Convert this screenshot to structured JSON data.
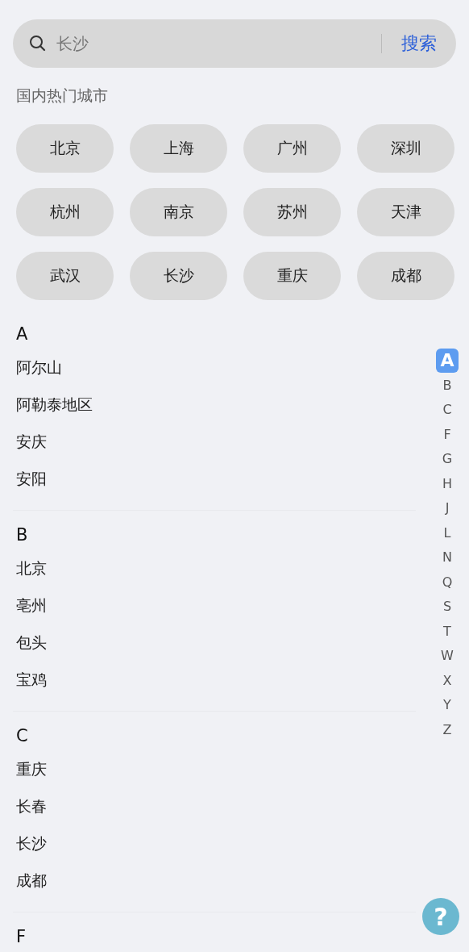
{
  "search": {
    "value": "长沙",
    "button": "搜索"
  },
  "hot_cities": {
    "title": "国内热门城市",
    "items": [
      "北京",
      "上海",
      "广州",
      "深圳",
      "杭州",
      "南京",
      "苏州",
      "天津",
      "武汉",
      "长沙",
      "重庆",
      "成都"
    ]
  },
  "sections": [
    {
      "letter": "A",
      "cities": [
        "阿尔山",
        "阿勒泰地区",
        "安庆",
        "安阳"
      ]
    },
    {
      "letter": "B",
      "cities": [
        "北京",
        "亳州",
        "包头",
        "宝鸡"
      ]
    },
    {
      "letter": "C",
      "cities": [
        "重庆",
        "长春",
        "长沙",
        "成都"
      ]
    },
    {
      "letter": "F"
    }
  ],
  "index_bar": [
    {
      "letter": "A",
      "selected": true
    },
    {
      "letter": "B",
      "selected": false
    },
    {
      "letter": "C",
      "selected": false
    },
    {
      "letter": "F",
      "selected": false
    },
    {
      "letter": "G",
      "selected": false
    },
    {
      "letter": "H",
      "selected": false
    },
    {
      "letter": "J",
      "selected": false
    },
    {
      "letter": "L",
      "selected": false
    },
    {
      "letter": "N",
      "selected": false
    },
    {
      "letter": "Q",
      "selected": false
    },
    {
      "letter": "S",
      "selected": false
    },
    {
      "letter": "T",
      "selected": false
    },
    {
      "letter": "W",
      "selected": false
    },
    {
      "letter": "X",
      "selected": false
    },
    {
      "letter": "Y",
      "selected": false
    },
    {
      "letter": "Z",
      "selected": false
    }
  ],
  "help_button": {
    "label": "?"
  }
}
